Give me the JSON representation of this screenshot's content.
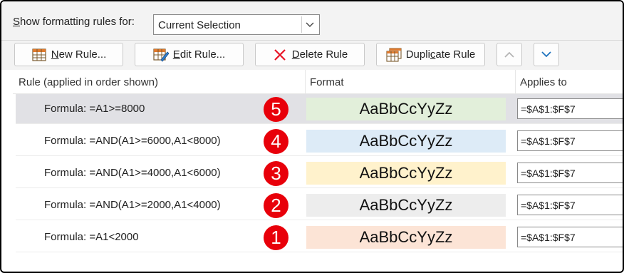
{
  "show_rules": {
    "label_prefix": "",
    "label_mnemonic": "S",
    "label_rest": "how formatting rules for:",
    "scope_value": "Current Selection"
  },
  "toolbar": {
    "new_rule": {
      "mnemonic": "N",
      "rest": "ew Rule..."
    },
    "edit_rule": {
      "mnemonic": "E",
      "rest": "dit Rule..."
    },
    "delete_rule": {
      "mnemonic": "D",
      "rest": "elete Rule"
    },
    "duplicate_rule": {
      "pre": "Dupli",
      "mnemonic": "c",
      "rest": "ate Rule"
    }
  },
  "columns": {
    "rule": "Rule (applied in order shown)",
    "format": "Format",
    "applies_to": "Applies to"
  },
  "rules": [
    {
      "formula": "Formula: =A1>=8000",
      "badge": "5",
      "preview": "AaBbCcYyZz",
      "fill": "#e2efda",
      "applies": "=$A$1:$F$7",
      "selected": true
    },
    {
      "formula": "Formula: =AND(A1>=6000,A1<8000)",
      "badge": "4",
      "preview": "AaBbCcYyZz",
      "fill": "#ddebf7",
      "applies": "=$A$1:$F$7",
      "selected": false
    },
    {
      "formula": "Formula: =AND(A1>=4000,A1<6000)",
      "badge": "3",
      "preview": "AaBbCcYyZz",
      "fill": "#fff2cc",
      "applies": "=$A$1:$F$7",
      "selected": false
    },
    {
      "formula": "Formula: =AND(A1>=2000,A1<4000)",
      "badge": "2",
      "preview": "AaBbCcYyZz",
      "fill": "#ededed",
      "applies": "=$A$1:$F$7",
      "selected": false
    },
    {
      "formula": "Formula: =A1<2000",
      "badge": "1",
      "preview": "AaBbCcYyZz",
      "fill": "#fce4d6",
      "applies": "=$A$1:$F$7",
      "selected": false
    }
  ],
  "icons": {
    "dropdown": "chevron-down-icon",
    "new_rule": "table-grid-icon",
    "edit_rule": "table-edit-icon",
    "delete_rule": "red-x-icon",
    "duplicate_rule": "table-copy-icon",
    "move_up": "chevron-up-icon",
    "move_down": "chevron-down-icon"
  },
  "colors": {
    "badge": "#e8000a",
    "selected_row": "#e1e1e5",
    "delete_x": "#e81123",
    "move_down_arrow": "#1e73be",
    "move_up_arrow": "#b5b5b5"
  }
}
